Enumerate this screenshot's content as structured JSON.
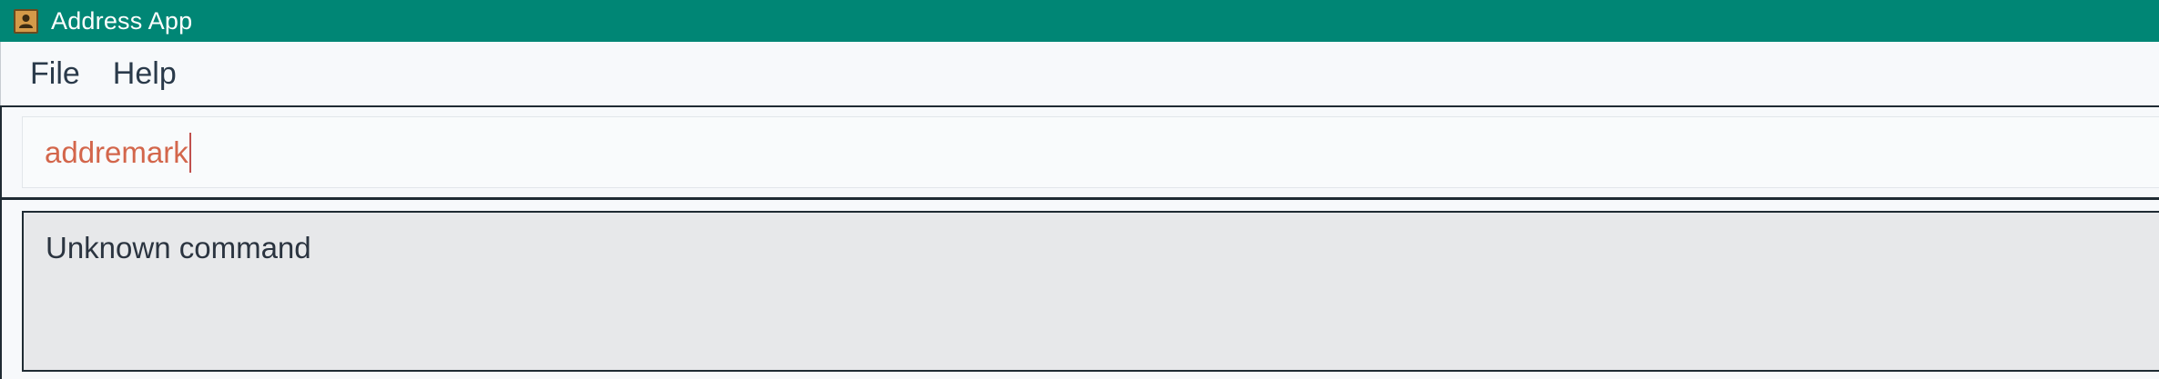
{
  "window": {
    "title": "Address App",
    "icon": "address-book-icon",
    "title_bar_color": "#008675"
  },
  "menu": {
    "items": [
      {
        "label": "File"
      },
      {
        "label": "Help"
      }
    ]
  },
  "command_box": {
    "value": "addremark",
    "text_color": "#d3664b"
  },
  "result_display": {
    "text": "Unknown command"
  }
}
